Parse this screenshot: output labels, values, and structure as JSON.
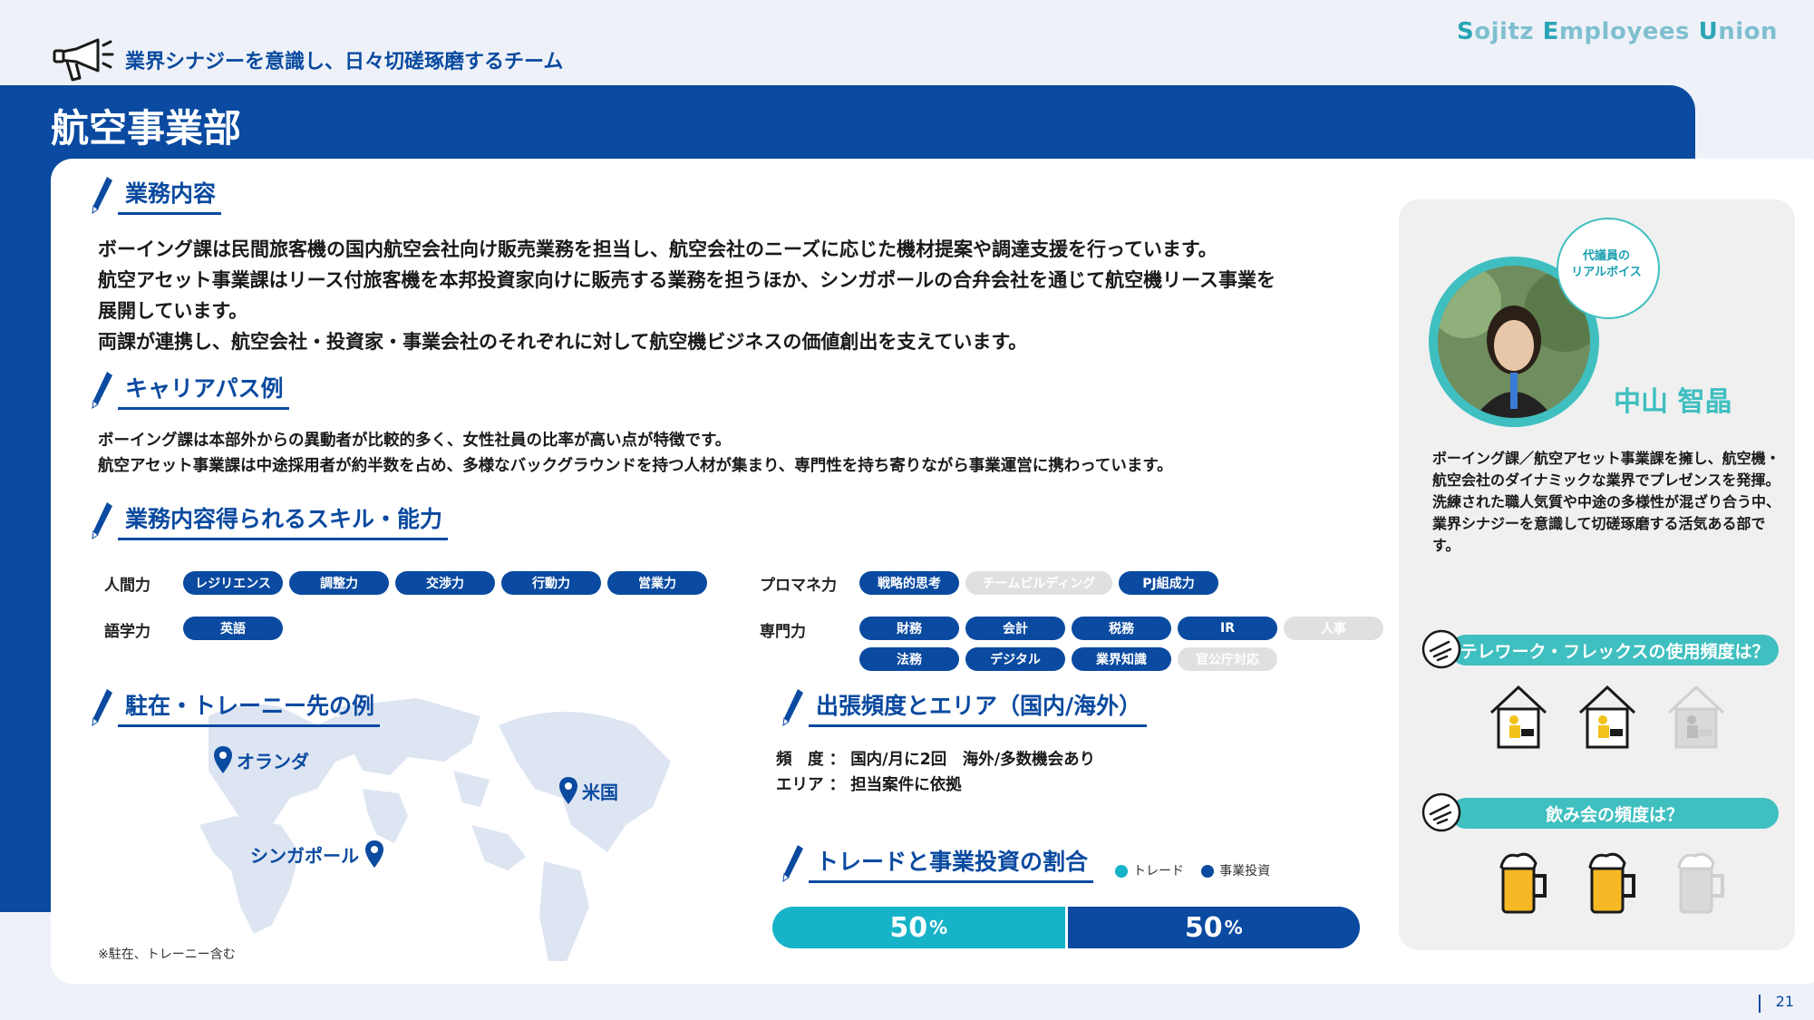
{
  "header": {
    "tagline": "業界シナジーを意識し、日々切磋琢磨するチーム",
    "brand_parts": [
      "S",
      "ojitz ",
      "E",
      "mployees ",
      "U",
      "nion"
    ],
    "department": "航空事業部"
  },
  "business": {
    "title": "業務内容",
    "lines": [
      "ボーイング課は民間旅客機の国内航空会社向け販売業務を担当し、航空会社のニーズに応じた機材提案や調達支援を行っています。",
      "航空アセット事業課はリース付旅客機を本邦投資家向けに販売する業務を担うほか、シンガポールの合弁会社を通じて航空機リース事業を",
      "展開しています。",
      "両課が連携し、航空会社・投資家・事業会社のそれぞれに対して航空機ビジネスの価値創出を支えています。"
    ]
  },
  "career": {
    "title": "キャリアパス例",
    "lines": [
      "ボーイング課は本部外からの異動者が比較的多く、女性社員の比率が高い点が特徴です。",
      "航空アセット事業課は中途採用者が約半数を占め、多様なバックグラウンドを持つ人材が集まり、専門性を持ち寄りながら事業運営に携わっています。"
    ]
  },
  "skills": {
    "title": "業務内容得られるスキル・能力",
    "human": {
      "label": "人間力",
      "items": [
        {
          "name": "レジリエンス",
          "on": true
        },
        {
          "name": "調整力",
          "on": true
        },
        {
          "name": "交渉力",
          "on": true
        },
        {
          "name": "行動力",
          "on": true
        },
        {
          "name": "営業力",
          "on": true
        }
      ]
    },
    "language": {
      "label": "語学力",
      "items": [
        {
          "name": "英語",
          "on": true
        }
      ]
    },
    "promane": {
      "label": "プロマネ力",
      "items": [
        {
          "name": "戦略的思考",
          "on": true
        },
        {
          "name": "チームビルディング",
          "on": false
        },
        {
          "name": "PJ組成力",
          "on": true
        }
      ]
    },
    "expert": {
      "label": "専門力",
      "items": [
        {
          "name": "財務",
          "on": true
        },
        {
          "name": "会計",
          "on": true
        },
        {
          "name": "税務",
          "on": true
        },
        {
          "name": "IR",
          "on": true
        },
        {
          "name": "人事",
          "on": false
        },
        {
          "name": "法務",
          "on": true
        },
        {
          "name": "デジタル",
          "on": true
        },
        {
          "name": "業界知識",
          "on": true
        },
        {
          "name": "官公庁対応",
          "on": false
        }
      ]
    }
  },
  "assignment": {
    "title": "駐在・トレーニー先の例",
    "places": [
      "オランダ",
      "米国",
      "シンガポール"
    ],
    "note": "※駐在、トレーニー含む"
  },
  "travel": {
    "title": "出張頻度とエリア（国内/海外）",
    "freq_label": "頻　度 ：",
    "freq_value": "国内/月に2回　海外/多数機会あり",
    "area_label": "エリア ：",
    "area_value": "担当案件に依拠"
  },
  "ratio": {
    "title": "トレードと事業投資の割合",
    "legend": [
      "トレード",
      "事業投資"
    ],
    "colors": [
      "#16b3c9",
      "#0a4aa0"
    ],
    "trade_pct": 50,
    "invest_pct": 50,
    "pct_sign": "%"
  },
  "rep": {
    "bubble": "代議員の\nリアルボイス",
    "name": "中山 智晶",
    "comment": "ボーイング課／航空アセット事業課を擁し、航空機・航空会社のダイナミックな業界でプレゼンスを発揮。洗練された職人気質や中途の多様性が混ざり合う中、業界シナジーを意識して切磋琢磨する活気ある部です。",
    "q_telework": "テレワーク・フレックスの使用頻度は？",
    "telework_level": 2,
    "telework_max": 3,
    "q_drinking": "飲み会の頻度は？",
    "drinking_level": 2,
    "drinking_max": 3
  },
  "page": {
    "number": "21"
  }
}
